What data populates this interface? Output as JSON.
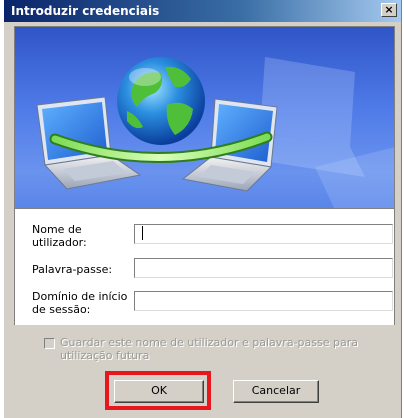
{
  "dialog": {
    "title": "Introduzir credenciais",
    "close_label": "×"
  },
  "form": {
    "username_label": "Nome de\nutilizador:",
    "username_value": "",
    "password_label": "Palavra-passe:",
    "password_value": "",
    "domain_label": "Domínio de início\nde sessão:",
    "domain_value": ""
  },
  "options": {
    "remember_label": "Guardar este nome de utilizador e palavra-passe para utilização futura",
    "remember_checked": false,
    "remember_disabled": true
  },
  "buttons": {
    "ok_label": "OK",
    "cancel_label": "Cancelar"
  },
  "colors": {
    "highlight": "#e8171e",
    "titlebar": "#0a246a",
    "banner": "#4f7be8"
  }
}
